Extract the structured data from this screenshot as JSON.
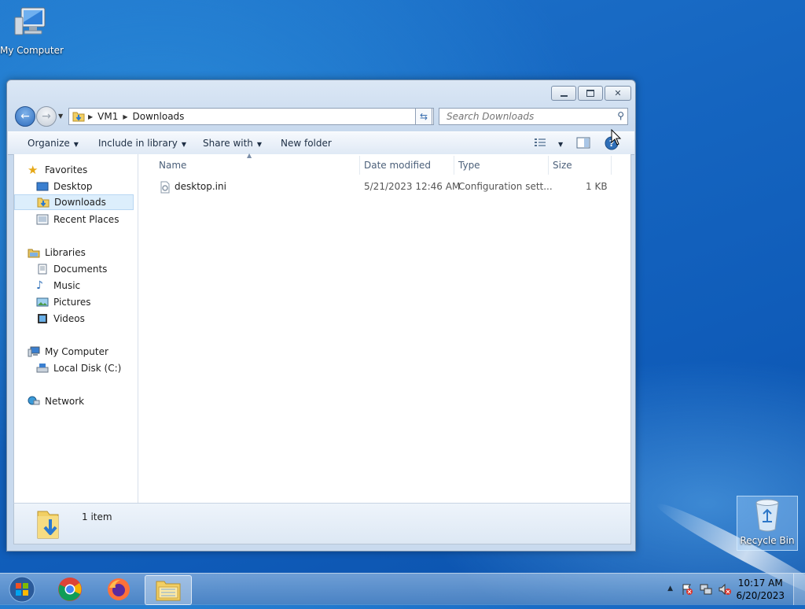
{
  "desktop": {
    "icons": [
      {
        "label": "My Computer"
      },
      {
        "label": "Recycle Bin"
      }
    ]
  },
  "window": {
    "caption_buttons": {
      "minimize": "minimize-icon",
      "maximize": "maximize-icon",
      "close": "close-icon"
    },
    "address": {
      "crumbs": [
        "VM1",
        "Downloads"
      ]
    },
    "search": {
      "placeholder": "Search Downloads"
    },
    "toolbar": {
      "organize": "Organize",
      "include_in_library": "Include in library",
      "share_with": "Share with",
      "new_folder": "New folder"
    },
    "nav": {
      "favorites": "Favorites",
      "desktop": "Desktop",
      "downloads": "Downloads",
      "recent_places": "Recent Places",
      "libraries": "Libraries",
      "documents": "Documents",
      "music": "Music",
      "pictures": "Pictures",
      "videos": "Videos",
      "my_computer": "My Computer",
      "local_disk": "Local Disk (C:)",
      "network": "Network"
    },
    "columns": {
      "name": "Name",
      "date_modified": "Date modified",
      "type": "Type",
      "size": "Size"
    },
    "files": [
      {
        "name": "desktop.ini",
        "date_modified": "5/21/2023 12:46 AM",
        "type": "Configuration sett...",
        "size": "1 KB"
      }
    ],
    "status": {
      "count": "1 item"
    }
  },
  "taskbar": {
    "clock_time": "10:17 AM",
    "clock_date": "6/20/2023"
  },
  "colors": {
    "accent": "#1565c0",
    "selection": "#dceefc"
  }
}
